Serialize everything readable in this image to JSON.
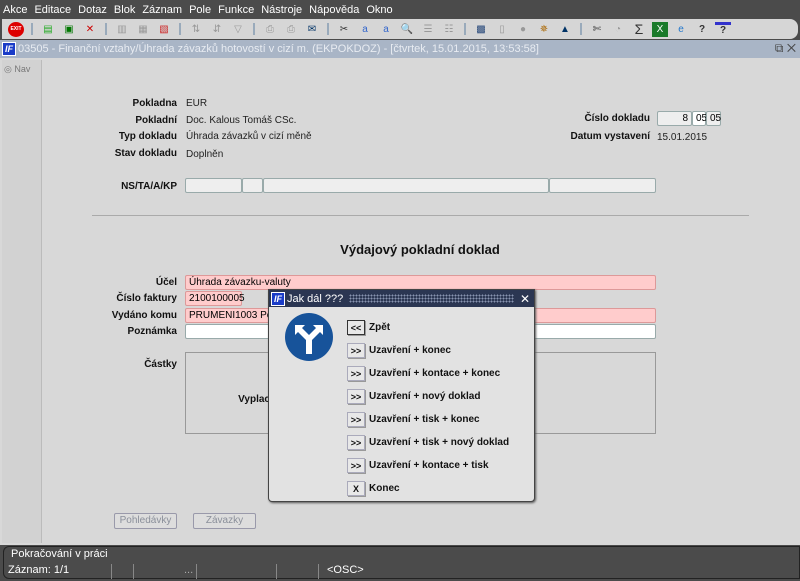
{
  "menu": [
    "Akce",
    "Editace",
    "Dotaz",
    "Blok",
    "Záznam",
    "Pole",
    "Funkce",
    "Nástroje",
    "Nápověda",
    "Okno"
  ],
  "toolbar": {
    "exit_label": "EXIT"
  },
  "window": {
    "title": "03505 - Finanční vztahy/Úhrada závazků hotovostí v cizí m. (EKPOKDOZ) - [čtvrtek, 15.01.2015, 13:53:58]",
    "logo": "IF"
  },
  "nav": {
    "label": "Nav"
  },
  "header": {
    "pokladna_label": "Pokladna",
    "pokladna": "EUR",
    "pokladni_label": "Pokladní",
    "pokladni": "Doc. Kalous Tomáš CSc.",
    "typ_label": "Typ dokladu",
    "typ": "Úhrada závazků v cizí měně",
    "stav_label": "Stav dokladu",
    "stav": "Doplněn",
    "cislo_label": "Číslo dokladu",
    "cislo": [
      "8",
      "05",
      "05"
    ],
    "datum_label": "Datum vystavení",
    "datum": "15.01.2015",
    "ns_label": "NS/TA/A/KP"
  },
  "section": {
    "title": "Výdajový pokladní doklad",
    "ucel_label": "Účel",
    "ucel": "Úhrada závazku-valuty",
    "faktura_label": "Číslo faktury",
    "faktura": "2100100005",
    "komu_label": "Vydáno komu",
    "komu": "PRUMENI1003 Petr",
    "poznamka_label": "Poznámka",
    "poznamka": "",
    "castky_label": "Částky",
    "vyplac_label": "Vyplac"
  },
  "buttons": {
    "pohledavky": "Pohledávky",
    "zavazky": "Závazky"
  },
  "dialog": {
    "title": "Jak dál ???",
    "close": "✕",
    "options": [
      {
        "btn": "<<",
        "label": "Zpět"
      },
      {
        "btn": ">>",
        "label": "Uzavření + konec"
      },
      {
        "btn": ">>",
        "label": "Uzavření + kontace + konec"
      },
      {
        "btn": ">>",
        "label": "Uzavření + nový doklad"
      },
      {
        "btn": ">>",
        "label": "Uzavření + tisk + konec"
      },
      {
        "btn": ">>",
        "label": "Uzavření + tisk + nový doklad"
      },
      {
        "btn": ">>",
        "label": "Uzavření + kontace + tisk"
      },
      {
        "btn": "X",
        "label": "Konec"
      }
    ]
  },
  "status": {
    "message": "Pokračování v práci",
    "record": "Záznam: 1/1",
    "ellipsis": "...",
    "mode": "<OSC>"
  }
}
